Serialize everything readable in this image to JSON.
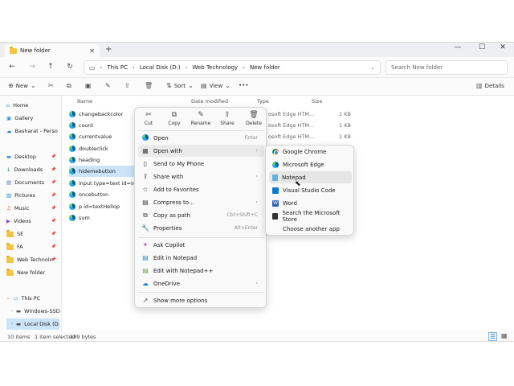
{
  "window": {
    "tab_title": "New folder",
    "controls": {
      "minimize": "—",
      "maximize": "☐",
      "close": "✕"
    }
  },
  "nav": {
    "breadcrumbs": [
      "This PC",
      "Local Disk (D:)",
      "Web Technology",
      "New folder"
    ],
    "search_placeholder": "Search New folder"
  },
  "toolbar": {
    "new_label": "New",
    "sort_label": "Sort",
    "view_label": "View",
    "more_label": "•••",
    "details_label": "Details"
  },
  "sidebar": {
    "items": [
      {
        "label": "Home",
        "icon": "home-icon"
      },
      {
        "label": "Gallery",
        "icon": "gallery-icon"
      },
      {
        "label": "Basharat - Perso",
        "icon": "cloud-icon"
      },
      {
        "label": "Desktop",
        "icon": "desktop-icon"
      },
      {
        "label": "Downloads",
        "icon": "download-icon"
      },
      {
        "label": "Documents",
        "icon": "document-icon"
      },
      {
        "label": "Pictures",
        "icon": "pictures-icon"
      },
      {
        "label": "Music",
        "icon": "music-icon"
      },
      {
        "label": "Videos",
        "icon": "video-icon"
      },
      {
        "label": "SE",
        "icon": "folder-icon"
      },
      {
        "label": "FA",
        "icon": "folder-icon"
      },
      {
        "label": "Web Technolo",
        "icon": "folder-icon"
      },
      {
        "label": "New folder",
        "icon": "folder-icon"
      },
      {
        "label": "This PC",
        "icon": "pc-icon"
      },
      {
        "label": "Windows-SSD",
        "icon": "drive-icon"
      },
      {
        "label": "Local Disk (D:)",
        "icon": "drive-icon"
      }
    ]
  },
  "columns": {
    "name": "Name",
    "date": "Date modified",
    "type": "Type",
    "size": "Size"
  },
  "files": [
    {
      "name": "changebackcolor",
      "type": "osoft Edge HTM...",
      "size": "1 KB"
    },
    {
      "name": "count",
      "type": "osoft Edge HTM...",
      "size": "1 KB"
    },
    {
      "name": "currentvalue",
      "type": "osoft Edge HTM...",
      "size": "1 KB"
    },
    {
      "name": "doubleclick",
      "type": "",
      "size": ""
    },
    {
      "name": "heading",
      "type": "",
      "size": ""
    },
    {
      "name": "hidemebutton",
      "type": "",
      "size": ""
    },
    {
      "name": "input type=text id=input",
      "type": "",
      "size": ""
    },
    {
      "name": "oncebutton",
      "type": "",
      "size": ""
    },
    {
      "name": "p id=textHellop",
      "type": "",
      "size": ""
    },
    {
      "name": "sum",
      "type": "",
      "size": ""
    }
  ],
  "status": {
    "items_count": "10 items",
    "selected": "1 item selected",
    "size": "189 bytes"
  },
  "context_menu": {
    "quick_actions": [
      {
        "label": "Cut",
        "icon": "✂"
      },
      {
        "label": "Copy",
        "icon": "⧉"
      },
      {
        "label": "Rename",
        "icon": "✎"
      },
      {
        "label": "Share",
        "icon": "⇪"
      },
      {
        "label": "Delete",
        "icon": "🗑"
      }
    ],
    "items": [
      {
        "label": "Open",
        "shortcut": "Enter",
        "icon": "edge"
      },
      {
        "label": "Open with",
        "shortcut": "›",
        "icon": "▦"
      },
      {
        "label": "Send to My Phone",
        "shortcut": "",
        "icon": "▯"
      },
      {
        "label": "Share with",
        "shortcut": "›",
        "icon": "⇪"
      },
      {
        "label": "Add to Favorites",
        "shortcut": "",
        "icon": "☆"
      },
      {
        "label": "Compress to...",
        "shortcut": "›",
        "icon": "▤"
      },
      {
        "label": "Copy as path",
        "shortcut": "Ctrl+Shift+C",
        "icon": "⧉"
      },
      {
        "label": "Properties",
        "shortcut": "Alt+Enter",
        "icon": "🔧"
      },
      {
        "label": "Ask Copilot",
        "shortcut": "",
        "icon": "✦"
      },
      {
        "label": "Edit in Notepad",
        "shortcut": "",
        "icon": "▤"
      },
      {
        "label": "Edit with Notepad++",
        "shortcut": "",
        "icon": "▤"
      },
      {
        "label": "OneDrive",
        "shortcut": "›",
        "icon": "☁"
      },
      {
        "label": "Show more options",
        "shortcut": "",
        "icon": "↗"
      }
    ]
  },
  "submenu": {
    "items": [
      {
        "label": "Google Chrome",
        "icon": "chrome-icon"
      },
      {
        "label": "Microsoft Edge",
        "icon": "edge-icon"
      },
      {
        "label": "Notepad",
        "icon": "notepad-icon"
      },
      {
        "label": "Visual Studio Code",
        "icon": "vscode-icon"
      },
      {
        "label": "Word",
        "icon": "word-icon"
      },
      {
        "label": "Search the Microsoft Store",
        "icon": "store-icon"
      },
      {
        "label": "Choose another app",
        "icon": ""
      }
    ]
  }
}
